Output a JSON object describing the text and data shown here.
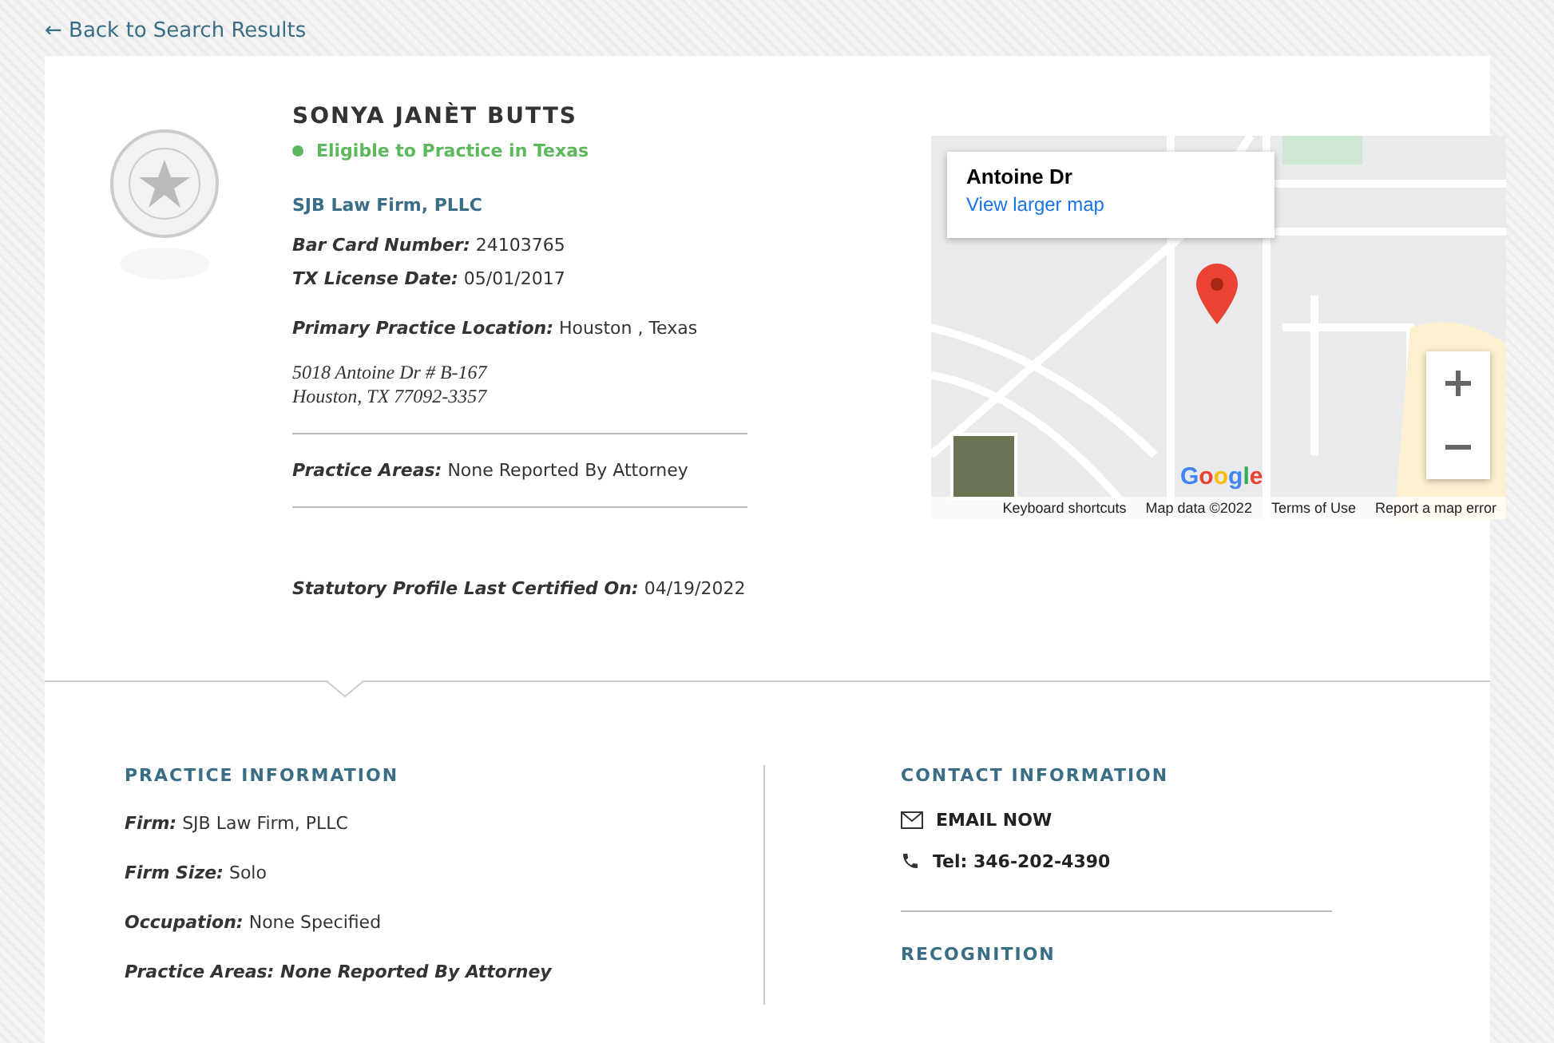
{
  "back_link": "← Back to Search Results",
  "profile": {
    "name": "SONYA JANÈT BUTTS",
    "status": {
      "label": "Eligible to Practice in Texas",
      "eligible": true
    },
    "firm": "SJB Law Firm, PLLC",
    "ids": [
      {
        "label": "Bar Card Number:",
        "value": "24103765"
      },
      {
        "label": "TX License Date:",
        "value": "05/01/2017"
      }
    ],
    "location": {
      "label": "Primary Practice Location:",
      "value": "Houston , Texas"
    },
    "address": [
      "5018 Antoine Dr # B-167",
      "Houston, TX 77092-3357"
    ],
    "practice_areas": {
      "label": "Practice Areas:",
      "value": "None Reported By Attorney"
    },
    "certified": {
      "label": "Statutory Profile Last Certified On:",
      "value": "04/19/2022"
    }
  },
  "map": {
    "place": "Antoine Dr",
    "link": "View larger map",
    "logo": "Google",
    "footer": [
      "Keyboard shortcuts",
      "Map data ©2022",
      "Terms of Use",
      "Report a map error"
    ]
  },
  "practice_information": {
    "title": "PRACTICE INFORMATION",
    "fields": [
      {
        "kind": "pair",
        "label": "Firm:",
        "value": "SJB Law Firm, PLLC"
      },
      {
        "kind": "pair",
        "label": "Firm Size:",
        "value": "Solo"
      },
      {
        "kind": "pair",
        "label": "Occupation:",
        "value": "None Specified"
      },
      {
        "kind": "emphasis",
        "label": "Practice Areas:",
        "value": "None Reported By Attorney"
      }
    ]
  },
  "contact_information": {
    "title": "CONTACT INFORMATION",
    "email": "EMAIL NOW",
    "phone": "Tel: 346-202-4390"
  },
  "recognition": {
    "title": "RECOGNITION"
  }
}
